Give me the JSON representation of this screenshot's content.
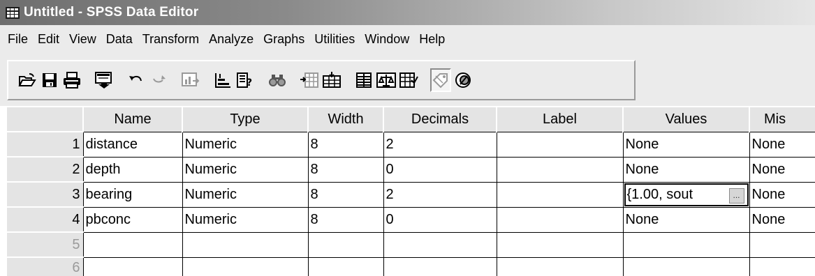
{
  "window": {
    "title": "Untitled - SPSS Data Editor",
    "icon": "spreadsheet-icon"
  },
  "menu": [
    "File",
    "Edit",
    "View",
    "Data",
    "Transform",
    "Analyze",
    "Graphs",
    "Utilities",
    "Window",
    "Help"
  ],
  "toolbar": {
    "buttons": [
      "open-icon",
      "save-icon",
      "print-icon",
      "dialog-recall-icon",
      "undo-icon",
      "redo-icon",
      "goto-chart-icon",
      "goto-case-icon",
      "variables-icon",
      "find-icon",
      "insert-case-icon",
      "insert-variable-icon",
      "split-file-icon",
      "weight-cases-icon",
      "select-cases-icon",
      "value-labels-icon",
      "use-sets-icon"
    ]
  },
  "grid": {
    "columns": [
      "Name",
      "Type",
      "Width",
      "Decimals",
      "Label",
      "Values",
      "Mis"
    ],
    "rows": [
      {
        "num": "1",
        "name": "distance",
        "type": "Numeric",
        "width": "8",
        "decimals": "2",
        "label": "",
        "values": "None",
        "missing": "None"
      },
      {
        "num": "2",
        "name": "depth",
        "type": "Numeric",
        "width": "8",
        "decimals": "0",
        "label": "",
        "values": "None",
        "missing": "None"
      },
      {
        "num": "3",
        "name": "bearing",
        "type": "Numeric",
        "width": "8",
        "decimals": "2",
        "label": "",
        "values": "{1.00, sout",
        "missing": "None"
      },
      {
        "num": "4",
        "name": "pbconc",
        "type": "Numeric",
        "width": "8",
        "decimals": "0",
        "label": "",
        "values": "None",
        "missing": "None"
      }
    ],
    "empty_rows": [
      "5",
      "6"
    ],
    "ellipsis": "..."
  }
}
